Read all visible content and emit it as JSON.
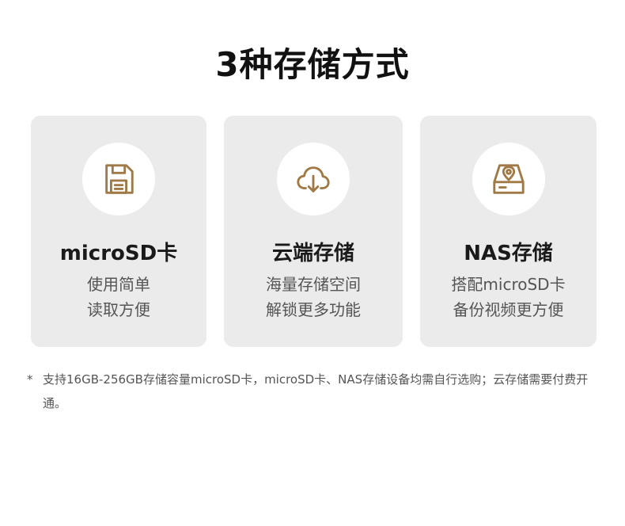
{
  "title": "3种存储方式",
  "colors": {
    "icon_accent": "#a07a46",
    "card_bg": "#ebebeb"
  },
  "cards": [
    {
      "icon": "floppy-disk-icon",
      "title": "microSD卡",
      "lines": [
        "使用简单",
        "读取方便"
      ]
    },
    {
      "icon": "cloud-download-icon",
      "title": "云端存储",
      "lines": [
        "海量存储空间",
        "解锁更多功能"
      ]
    },
    {
      "icon": "hard-drive-location-icon",
      "title": "NAS存储",
      "lines": [
        "搭配microSD卡",
        "备份视频更方便"
      ]
    }
  ],
  "footnote": {
    "marker": "*",
    "text": "支持16GB-256GB存储容量microSD卡，microSD卡、NAS存储设备均需自行选购；云存储需要付费开通。"
  }
}
